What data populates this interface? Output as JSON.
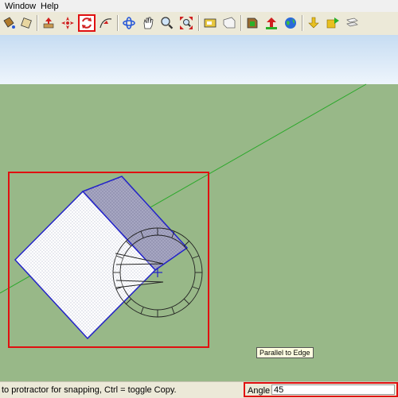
{
  "menu": {
    "items": [
      "Window",
      "Help"
    ]
  },
  "toolbar": {
    "buttons": [
      "paint-bucket-icon",
      "push-pull-icon",
      "move-icon",
      "rotate-icon",
      "follow-me-icon",
      "orbit-icon",
      "pan-icon",
      "zoom-icon",
      "zoom-extents-icon",
      "component-icon",
      "warehouse-icon",
      "get-models-icon",
      "share-model-icon",
      "earth-icon",
      "import-icon",
      "export-icon",
      "layers-icon"
    ],
    "active_tool": "rotate-icon"
  },
  "viewport": {
    "tooltip": "Parallel to Edge",
    "sky_color": "#e6f1fb",
    "ground_color": "#98b888"
  },
  "status": {
    "hint": "to protractor for snapping, Ctrl = toggle Copy."
  },
  "vcb": {
    "label": "Angle",
    "value": "45"
  },
  "colors": {
    "highlight_red": "#e01010",
    "selection_blue": "#2323c8",
    "axis_green": "#2aa82a"
  }
}
